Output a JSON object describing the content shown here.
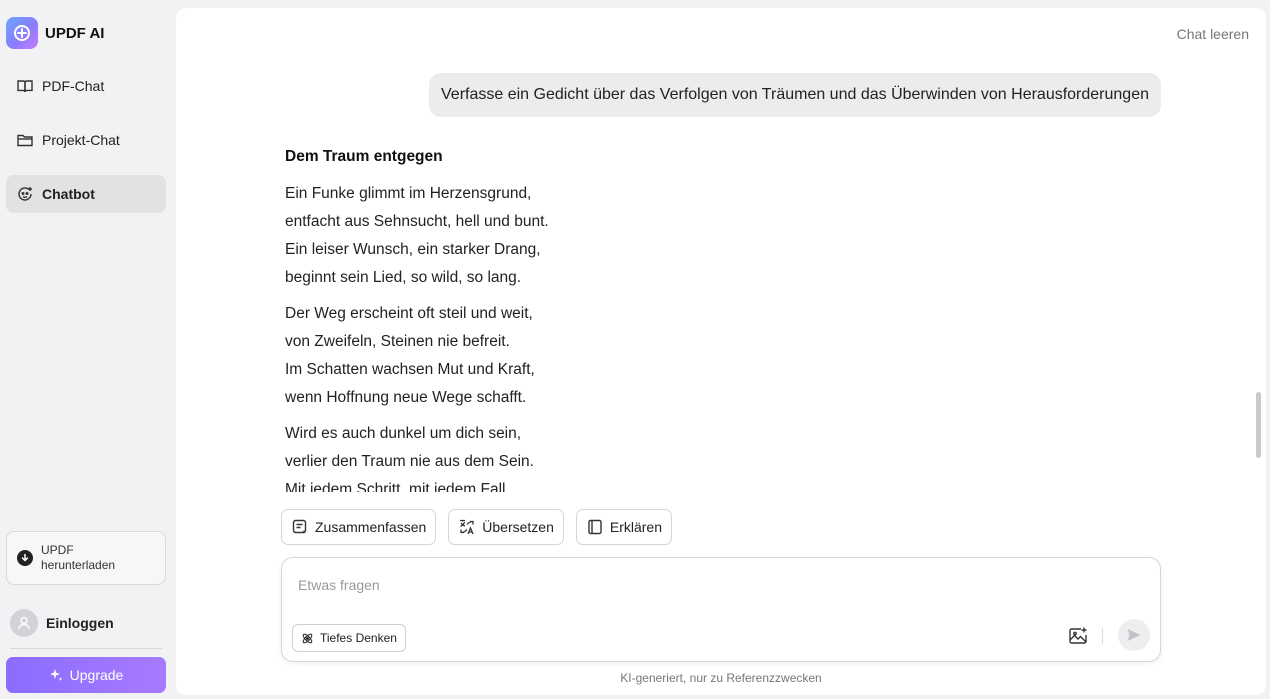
{
  "brand": {
    "name": "UPDF AI"
  },
  "sidebar": {
    "items": [
      {
        "label": "PDF-Chat",
        "icon": "book-open-icon"
      },
      {
        "label": "Projekt-Chat",
        "icon": "folder-icon"
      },
      {
        "label": "Chatbot",
        "icon": "chatbot-icon",
        "active": true
      }
    ],
    "download": {
      "line1": "UPDF",
      "line2": "herunterladen"
    },
    "login_label": "Einloggen",
    "upgrade_label": "Upgrade"
  },
  "header": {
    "clear_chat": "Chat leeren"
  },
  "chat": {
    "user_message": "Verfasse ein Gedicht über das Verfolgen von Träumen und das Überwinden von Herausforderungen",
    "answer": {
      "title": "Dem Traum entgegen",
      "stanzas": [
        [
          "Ein Funke glimmt im Herzensgrund,",
          "entfacht aus Sehnsucht, hell und bunt.",
          "Ein leiser Wunsch, ein starker Drang,",
          "beginnt sein Lied, so wild, so lang."
        ],
        [
          "Der Weg erscheint oft steil und weit,",
          "von Zweifeln, Steinen nie befreit.",
          "Im Schatten wachsen Mut und Kraft,",
          "wenn Hoffnung neue Wege schafft."
        ],
        [
          "Wird es auch dunkel um dich sein,",
          "verlier den Traum nie aus dem Sein.",
          "Mit jedem Schritt, mit jedem Fall"
        ]
      ]
    }
  },
  "actions": {
    "summarize": "Zusammenfassen",
    "translate": "Übersetzen",
    "explain": "Erklären"
  },
  "input": {
    "placeholder": "Etwas fragen",
    "value": "",
    "deep_think": "Tiefes Denken"
  },
  "footer": {
    "disclaimer": "KI-generiert, nur zu Referenzzwecken"
  },
  "colors": {
    "accent": "#8b6cff",
    "active_nav": "#e2e2e5",
    "background": "#f2f2f4"
  }
}
